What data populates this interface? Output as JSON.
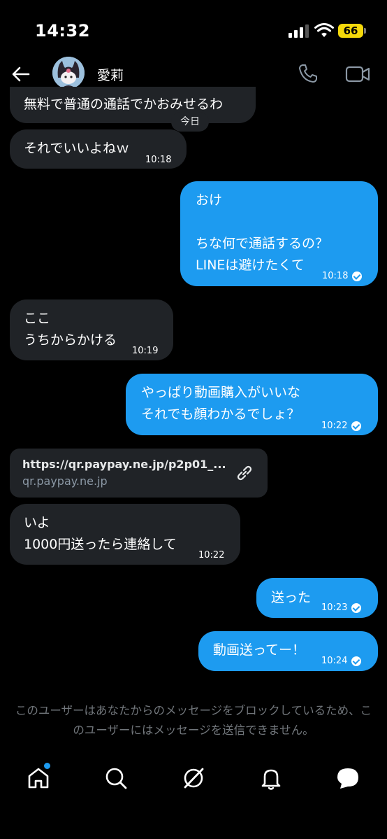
{
  "status_bar": {
    "time": "14:32",
    "battery": "66"
  },
  "header": {
    "name": "愛莉"
  },
  "date_divider": "今日",
  "messages": [
    {
      "dir": "in",
      "text": "無料で普通の通話でかおみせるわ"
    },
    {
      "dir": "in",
      "text": "それでいいよねｗ",
      "time": "10:18"
    },
    {
      "dir": "out",
      "text": "おけ\n\nちな何で通話するの？\nLINEは避けたくて",
      "time": "10:18"
    },
    {
      "dir": "in",
      "text": "ここ\nうちからかける",
      "time": "10:19"
    },
    {
      "dir": "out",
      "text": "やっぱり動画購入がいいな\nそれでも顔わかるでしょ？",
      "time": "10:22"
    },
    {
      "dir": "in",
      "link": {
        "title": "https://qr.paypay.ne.jp/p2p01_...",
        "domain": "qr.paypay.ne.jp"
      }
    },
    {
      "dir": "in",
      "text": "いよ\n1000円送ったら連絡して",
      "time": "10:22"
    },
    {
      "dir": "out",
      "text": "送った",
      "time": "10:23"
    },
    {
      "dir": "out",
      "text": "動画送ってー！",
      "time": "10:24"
    }
  ],
  "blocked_notice": "このユーザーはあなたからのメッセージをブロックしているため、このユーザーにはメッセージを送信できません。",
  "icons": {
    "back": "arrow-left-icon",
    "call": "phone-icon",
    "video": "video-camera-icon",
    "link": "link-icon",
    "home": "home-icon",
    "search": "search-icon",
    "grok": "grok-icon",
    "notifications": "bell-icon",
    "messages": "chat-bubble-icon"
  },
  "colors": {
    "outgoing": "#1d9bf0",
    "incoming": "#202327",
    "badge": "#f5d90a",
    "unread_dot": "#1d9bf0"
  }
}
